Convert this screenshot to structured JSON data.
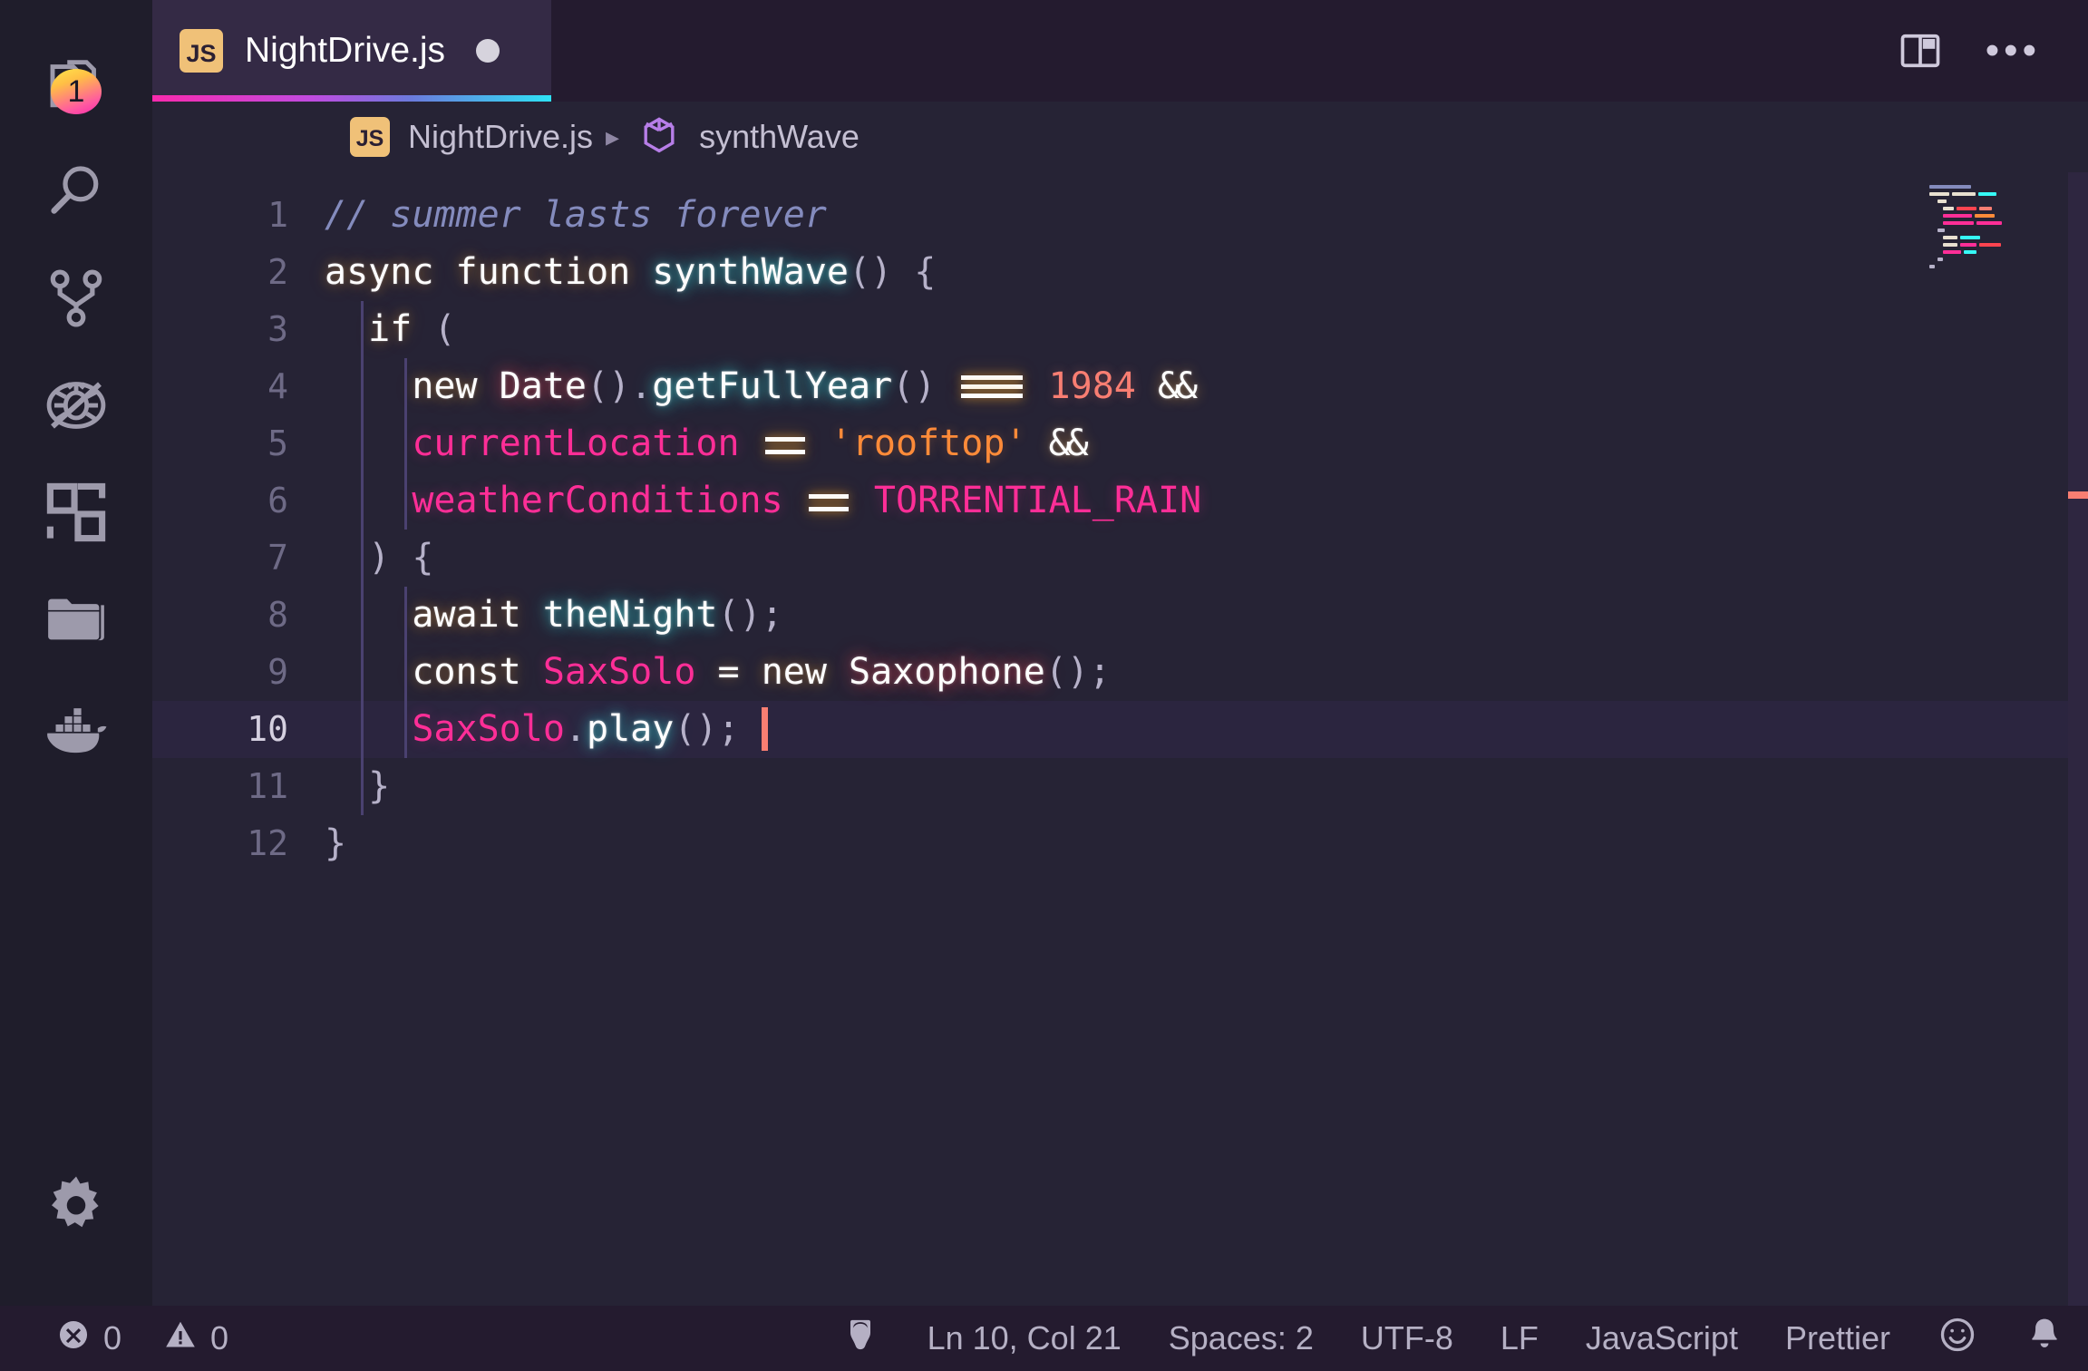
{
  "window": {
    "theme_name": "SynthWave '84",
    "background": "#262335"
  },
  "activity_bar": {
    "items": [
      {
        "name": "explorer",
        "icon": "files-icon",
        "badge": "1"
      },
      {
        "name": "search",
        "icon": "search-icon",
        "badge": ""
      },
      {
        "name": "source-control",
        "icon": "source-control-icon",
        "badge": ""
      },
      {
        "name": "run-and-debug",
        "icon": "run-debug-icon",
        "badge": ""
      },
      {
        "name": "extensions",
        "icon": "extensions-icon",
        "badge": ""
      },
      {
        "name": "remote-explorer",
        "icon": "folder-icon",
        "badge": ""
      },
      {
        "name": "docker",
        "icon": "docker-whale-icon",
        "badge": ""
      }
    ],
    "bottom_items": [
      {
        "name": "manage",
        "icon": "gear-icon",
        "badge": ""
      }
    ]
  },
  "tab_bar": {
    "tabs": [
      {
        "label": "NightDrive.js",
        "file_icon": "js-icon",
        "file_icon_text": "JS",
        "dirty": true,
        "active": true
      }
    ],
    "actions": [
      {
        "name": "split-editor-right",
        "icon": "split-editor-icon"
      },
      {
        "name": "more-actions",
        "icon": "ellipsis-icon",
        "glyph": "•••"
      }
    ],
    "underline_gradient": [
      "#f92aad",
      "#c04be0",
      "#6b7bdd",
      "#2ee2f5"
    ]
  },
  "breadcrumb": {
    "segments": [
      {
        "label": "NightDrive.js",
        "icon": "js-icon",
        "icon_text": "JS"
      },
      {
        "label": "synthWave",
        "icon": "symbol-method-cube-icon"
      }
    ],
    "separator": "▸"
  },
  "editor": {
    "language": "JavaScript",
    "cursor": {
      "line": 10,
      "column": 21
    },
    "lines": [
      {
        "n": "1",
        "text": "// summer lasts forever"
      },
      {
        "n": "2",
        "text": "async function synthWave() {"
      },
      {
        "n": "3",
        "text": "  if ("
      },
      {
        "n": "4",
        "text": "    new Date().getFullYear() === 1984 &&"
      },
      {
        "n": "5",
        "text": "    currentLocation == 'rooftop' &&"
      },
      {
        "n": "6",
        "text": "    weatherConditions == TORRENTIAL_RAIN"
      },
      {
        "n": "7",
        "text": "  ) {"
      },
      {
        "n": "8",
        "text": "    await theNight();"
      },
      {
        "n": "9",
        "text": "    const SaxSolo = new Saxophone();"
      },
      {
        "n": "10",
        "text": "    SaxSolo.play();",
        "active": true
      },
      {
        "n": "11",
        "text": "  }"
      },
      {
        "n": "12",
        "text": "}"
      }
    ],
    "tokens": {
      "comment": "// summer lasts forever",
      "l2": {
        "async": "async",
        "function": "function",
        "name": "synthWave",
        "parens": "()",
        "brace": "{"
      },
      "l3": {
        "if": "if",
        "paren": "("
      },
      "l4": {
        "new": "new",
        "date": "Date",
        "parens": "()",
        "dot": ".",
        "method": "getFullYear",
        "parens2": "()",
        "eq": "===",
        "num": "1984",
        "and": "&&"
      },
      "l5": {
        "var": "currentLocation",
        "eq": "==",
        "str": "'rooftop'",
        "and": "&&"
      },
      "l6": {
        "var": "weatherConditions",
        "eq": "==",
        "const": "TORRENTIAL_RAIN"
      },
      "l7": {
        "close": ")",
        "brace": "{"
      },
      "l8": {
        "await": "await",
        "fn": "theNight",
        "parens": "()",
        "semi": ";"
      },
      "l9": {
        "const": "const",
        "name": "SaxSolo",
        "assign": "=",
        "new": "new",
        "cls": "Saxophone",
        "parens": "()",
        "semi": ";"
      },
      "l10": {
        "obj": "SaxSolo",
        "dot": ".",
        "method": "play",
        "parens": "()",
        "semi": ";"
      },
      "l11": {
        "brace": "}"
      },
      "l12": {
        "brace": "}"
      }
    },
    "colors": {
      "comment": "#848bbd",
      "keyword": "#fdfdfd",
      "function": "#36f9f6",
      "variable": "#ff7edb",
      "pink": "#ff2e97",
      "string": "#ff8b39",
      "number": "#f97e72",
      "punctuation": "#b6b1c9",
      "class": "#fe4450",
      "cursor": "#f97e72",
      "background": "#262335",
      "line_highlight": "#34294f"
    }
  },
  "status_bar": {
    "errors_icon": "error-circle-icon",
    "errors": "0",
    "warnings_icon": "warning-triangle-icon",
    "warnings": "0",
    "theme_icon": "paint-bucket-icon",
    "position": "Ln 10, Col 21",
    "indentation": "Spaces: 2",
    "encoding": "UTF-8",
    "eol": "LF",
    "language": "JavaScript",
    "formatter": "Prettier",
    "feedback_icon": "smiley-icon",
    "notifications_icon": "bell-icon"
  }
}
